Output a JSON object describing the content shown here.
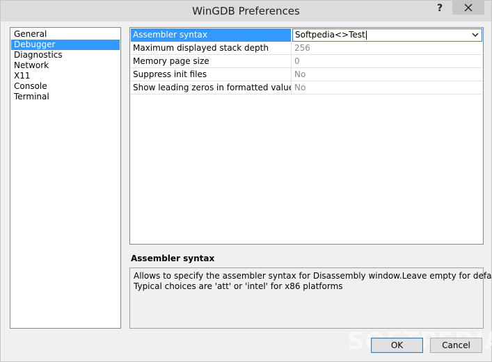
{
  "window": {
    "title": "WinGDB Preferences",
    "help_label": "?",
    "close_icon": "close-icon"
  },
  "categories": [
    {
      "label": "General",
      "selected": false
    },
    {
      "label": "Debugger",
      "selected": true
    },
    {
      "label": "Diagnostics",
      "selected": false
    },
    {
      "label": "Network",
      "selected": false
    },
    {
      "label": "X11",
      "selected": false
    },
    {
      "label": "Console",
      "selected": false
    },
    {
      "label": "Terminal",
      "selected": false
    }
  ],
  "properties": [
    {
      "name": "Assembler syntax",
      "value": "Softpedia<>Test",
      "selected": true
    },
    {
      "name": "Maximum displayed stack depth",
      "value": "256",
      "selected": false
    },
    {
      "name": "Memory page size",
      "value": "0",
      "selected": false
    },
    {
      "name": "Suppress init files",
      "value": "No",
      "selected": false
    },
    {
      "name": "Show leading zeros in formatted values",
      "value": "No",
      "selected": false
    }
  ],
  "description": {
    "title": "Assembler syntax",
    "line1": "Allows to specify the assembler syntax for Disassembly window.Leave empty for default.",
    "line2": "Typical choices are 'att' or 'intel' for x86 platforms"
  },
  "buttons": {
    "ok_label": "OK",
    "cancel_label": "Cancel"
  },
  "watermark": "SOFTPEDIA",
  "colors": {
    "selection": "#3399ff",
    "edit_border": "#3a7bd5"
  }
}
